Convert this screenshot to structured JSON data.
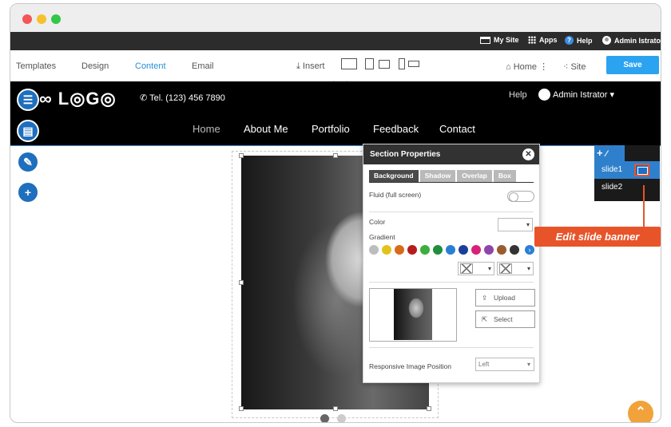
{
  "topbar": {
    "mysite": "My Site",
    "apps": "Apps",
    "help": "Help",
    "admin": "Admin Istrator"
  },
  "menubar": {
    "templates": "Templates",
    "design": "Design",
    "content": "Content",
    "email": "Email",
    "insert": "Insert",
    "home": "Home",
    "site": "Site",
    "save": "Save"
  },
  "site": {
    "logo": "∞ L◎G◎",
    "tel": "Tel. (123) 456 7890",
    "help": "Help",
    "admin": "Admin Istrator",
    "nav": [
      "Home",
      "About Me",
      "Portfolio",
      "Feedback",
      "Contact"
    ]
  },
  "panel": {
    "title": "Section Properties",
    "tabs": [
      "Background",
      "Shadow",
      "Overlap",
      "Box"
    ],
    "fluid": "Fluid (full screen)",
    "color": "Color",
    "gradient": "Gradient",
    "upload": "Upload",
    "select": "Select",
    "responsive": "Responsive Image Position",
    "position_value": "Left",
    "swatches": [
      "#bdbdbd",
      "#e3c21b",
      "#d86a19",
      "#b71c1c",
      "#3cae3c",
      "#1f8f3c",
      "#2a7fd4",
      "#1a3f9a",
      "#d8227a",
      "#8e44ad",
      "#9b5b2f",
      "#333333"
    ]
  },
  "slides": {
    "items": [
      "slide1",
      "slide2"
    ],
    "callout": "Edit slide banner"
  },
  "colors": {
    "accent": "#2ba3f0",
    "callout": "#e8542a",
    "scrolltop": "#f2a23a"
  }
}
